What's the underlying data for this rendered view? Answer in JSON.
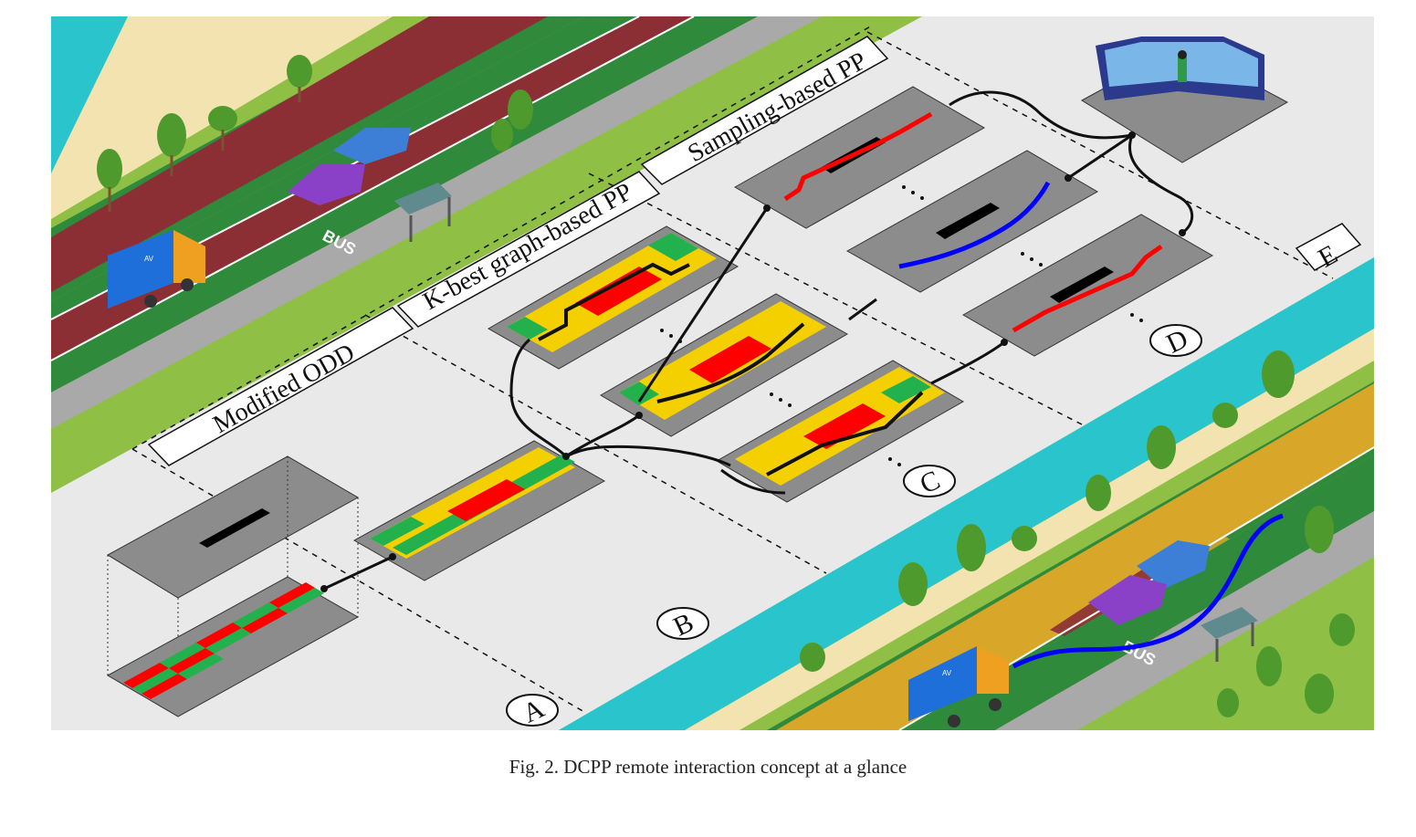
{
  "labels": {
    "modified_odd": "Modified ODD",
    "kbest": "K-best graph-based PP",
    "sampling": "Sampling-based PP"
  },
  "markers": {
    "a": "A",
    "b": "B",
    "c": "C",
    "d": "D",
    "e": "E"
  },
  "road": {
    "bus_lane_top": "BUS",
    "bus_lane_bottom": "BUS",
    "truck_label_top": "AV",
    "truck_label_bottom": "AV"
  },
  "caption": "Fig. 2.  DCPP remote interaction concept at a glance",
  "colors": {
    "water": "#29c4cc",
    "sand": "#f2e3b0",
    "grass": "#8fbf45",
    "dark_grass": "#2f8a3c",
    "bus_lane_top": "#8c2f35",
    "bus_lane_bottom": "#d8a628",
    "sidewalk": "#a9a9a9",
    "panel_gray": "#8c8c8c",
    "cell_red": "#ff0000",
    "cell_green": "#22b14c",
    "cell_yellow": "#f5d000",
    "path_red": "#ff0000",
    "path_blue": "#0000ff",
    "truck_body": "#1e6fd9",
    "truck_cab": "#f0a020"
  }
}
